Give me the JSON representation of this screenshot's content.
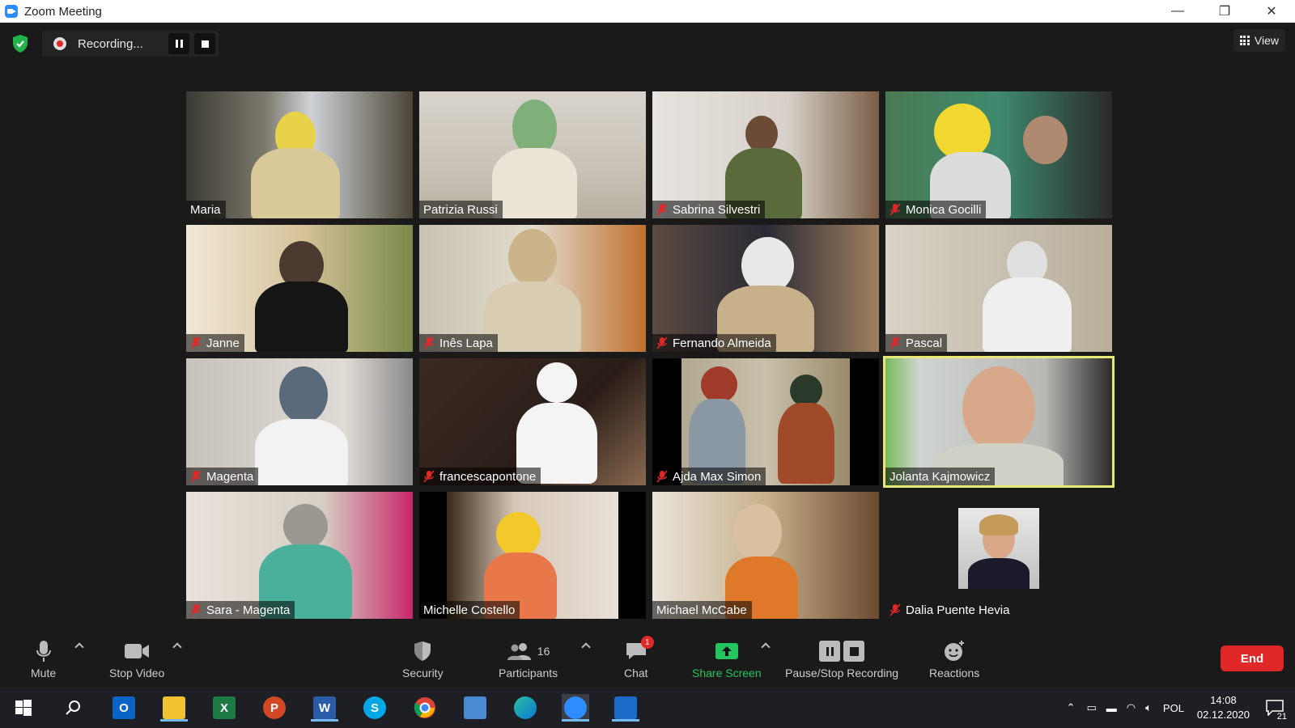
{
  "window": {
    "title": "Zoom Meeting",
    "minimize": "—",
    "restore": "❐",
    "close": "✕"
  },
  "recording": {
    "label": "Recording..."
  },
  "view": {
    "label": "View"
  },
  "participants_tiles": [
    {
      "name": "Maria",
      "muted": false
    },
    {
      "name": "Patrizia Russi",
      "muted": false
    },
    {
      "name": "Sabrina Silvestri",
      "muted": true
    },
    {
      "name": "Monica Gocilli",
      "muted": true
    },
    {
      "name": "Janne",
      "muted": true
    },
    {
      "name": "Inês Lapa",
      "muted": true
    },
    {
      "name": "Fernando Almeida",
      "muted": true
    },
    {
      "name": "Pascal",
      "muted": true
    },
    {
      "name": "Magenta",
      "muted": true
    },
    {
      "name": "francescapontone",
      "muted": true
    },
    {
      "name": "Ajda Max Simon",
      "muted": true
    },
    {
      "name": "Jolanta Kajmowicz",
      "muted": false,
      "active": true
    },
    {
      "name": "Sara - Magenta",
      "muted": true
    },
    {
      "name": "Michelle Costello",
      "muted": false
    },
    {
      "name": "Michael McCabe",
      "muted": false
    },
    {
      "name": "Dalia Puente Hevia",
      "muted": true
    }
  ],
  "toolbar": {
    "mute": "Mute",
    "stop_video": "Stop Video",
    "security": "Security",
    "participants": "Participants",
    "participants_count": "16",
    "chat": "Chat",
    "chat_badge": "1",
    "share_screen": "Share Screen",
    "pause_stop_recording": "Pause/Stop Recording",
    "reactions": "Reactions",
    "end": "End"
  },
  "colors": {
    "share_green": "#22c55e",
    "end_red": "#e02828",
    "active_speaker": "#e8e87a"
  },
  "taskbar": {
    "language": "POL",
    "time": "14:08",
    "date": "02.12.2020",
    "notifications": "21"
  }
}
